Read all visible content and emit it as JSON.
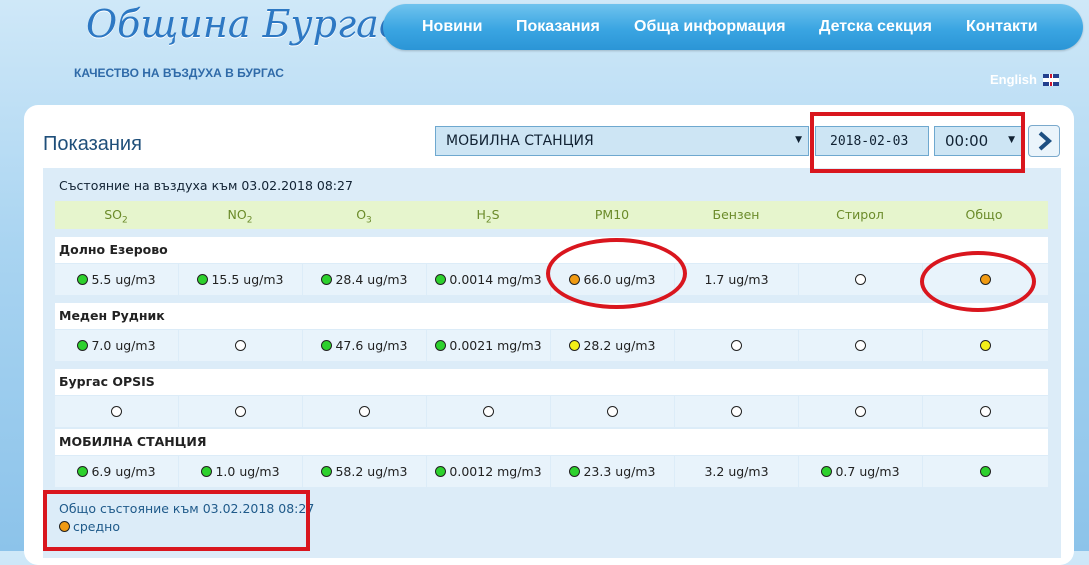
{
  "header": {
    "logo": "Община Бургас",
    "tagline": "КАЧЕСТВО НА ВЪЗДУХА В БУРГАС",
    "nav": [
      "Новини",
      "Показания",
      "Обща информация",
      "Детска секция",
      "Контакти"
    ],
    "language": "English"
  },
  "page": {
    "title": "Показания",
    "station_select": "МОБИЛНА СТАНЦИЯ",
    "date": "2018-02-03",
    "time": "00:00"
  },
  "table": {
    "status_title": "Състояние на въздуха към 03.02.2018 08:27",
    "columns": [
      "SO2",
      "NO2",
      "O3",
      "H2S",
      "PM10",
      "Бензен",
      "Стирол",
      "Общо"
    ],
    "stations": [
      {
        "name": "Долно Езерово",
        "cells": [
          {
            "color": "green",
            "text": "5.5 ug/m3"
          },
          {
            "color": "green",
            "text": "15.5 ug/m3"
          },
          {
            "color": "green",
            "text": "28.4 ug/m3"
          },
          {
            "color": "green",
            "text": "0.0014 mg/m3"
          },
          {
            "color": "orange",
            "text": "66.0 ug/m3"
          },
          {
            "color": "none",
            "text": "1.7 ug/m3"
          },
          {
            "color": "empty",
            "text": ""
          },
          {
            "color": "orange",
            "text": ""
          }
        ]
      },
      {
        "name": "Меден Рудник",
        "cells": [
          {
            "color": "green",
            "text": "7.0 ug/m3"
          },
          {
            "color": "empty",
            "text": ""
          },
          {
            "color": "green",
            "text": "47.6 ug/m3"
          },
          {
            "color": "green",
            "text": "0.0021 mg/m3"
          },
          {
            "color": "yellow",
            "text": "28.2 ug/m3"
          },
          {
            "color": "empty",
            "text": ""
          },
          {
            "color": "empty",
            "text": ""
          },
          {
            "color": "yellow",
            "text": ""
          }
        ]
      },
      {
        "name": "Бургас OPSIS",
        "cells": [
          {
            "color": "empty",
            "text": ""
          },
          {
            "color": "empty",
            "text": ""
          },
          {
            "color": "empty",
            "text": ""
          },
          {
            "color": "empty",
            "text": ""
          },
          {
            "color": "empty",
            "text": ""
          },
          {
            "color": "empty",
            "text": ""
          },
          {
            "color": "empty",
            "text": ""
          },
          {
            "color": "empty",
            "text": ""
          }
        ]
      },
      {
        "name": "МОБИЛНА СТАНЦИЯ",
        "cells": [
          {
            "color": "green",
            "text": "6.9 ug/m3"
          },
          {
            "color": "green",
            "text": "1.0 ug/m3"
          },
          {
            "color": "green",
            "text": "58.2 ug/m3"
          },
          {
            "color": "green",
            "text": "0.0012 mg/m3"
          },
          {
            "color": "green",
            "text": "23.3 ug/m3"
          },
          {
            "color": "none",
            "text": "3.2 ug/m3"
          },
          {
            "color": "green",
            "text": "0.7 ug/m3"
          },
          {
            "color": "green",
            "text": ""
          }
        ]
      }
    ]
  },
  "summary": {
    "title": "Общо състояние към 03.02.2018 08:27",
    "level_color": "orange",
    "level": "средно"
  },
  "colors": {
    "green": "#2dd12d",
    "orange": "#f09a12",
    "yellow": "#f3ef17",
    "annotation": "#d9161e",
    "nav": "#3aa5e2"
  }
}
